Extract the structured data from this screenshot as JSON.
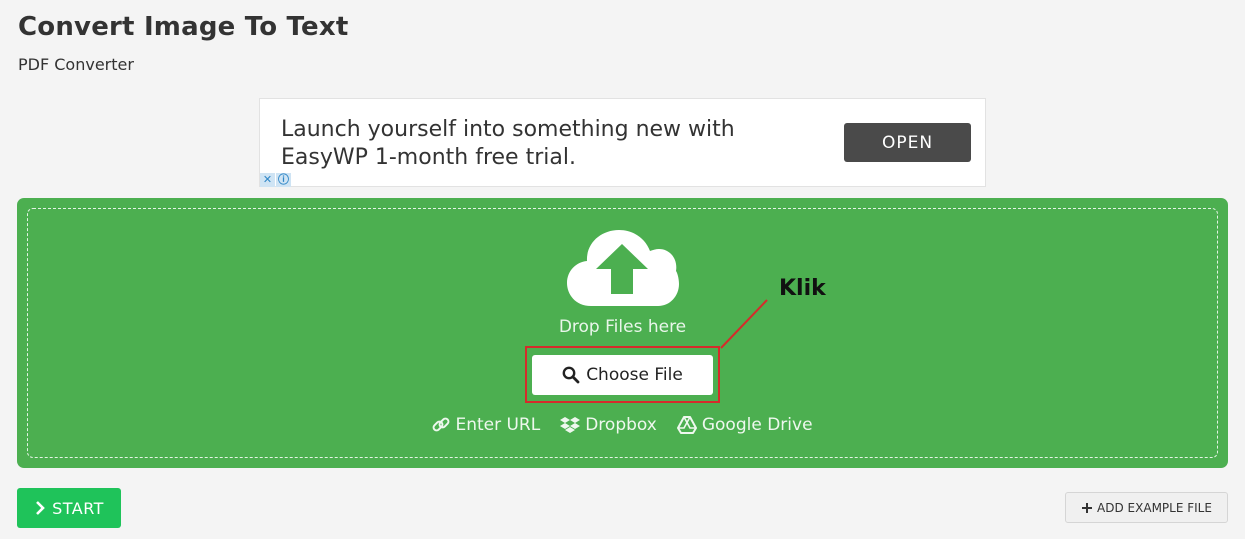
{
  "header": {
    "title": "Convert Image To Text",
    "subtitle": "PDF Converter"
  },
  "ad": {
    "text": "Launch yourself into something new with EasyWP 1-month free trial.",
    "button_label": "OPEN",
    "close_mark": "✕",
    "info_mark": "ⓘ"
  },
  "upload": {
    "icon": "cloud-upload-icon",
    "drop_text": "Drop Files here",
    "choose_label": "Choose File",
    "choose_icon": "search-icon",
    "sources": [
      {
        "label": "Enter URL",
        "icon": "link-icon"
      },
      {
        "label": "Dropbox",
        "icon": "dropbox-icon"
      },
      {
        "label": "Google Drive",
        "icon": "google-drive-icon"
      }
    ],
    "annotation_label": "Klik",
    "annotation_color": "#d62b2b",
    "background_color": "#4caf50"
  },
  "actions": {
    "start_label": "START",
    "example_label": "ADD EXAMPLE FILE"
  }
}
